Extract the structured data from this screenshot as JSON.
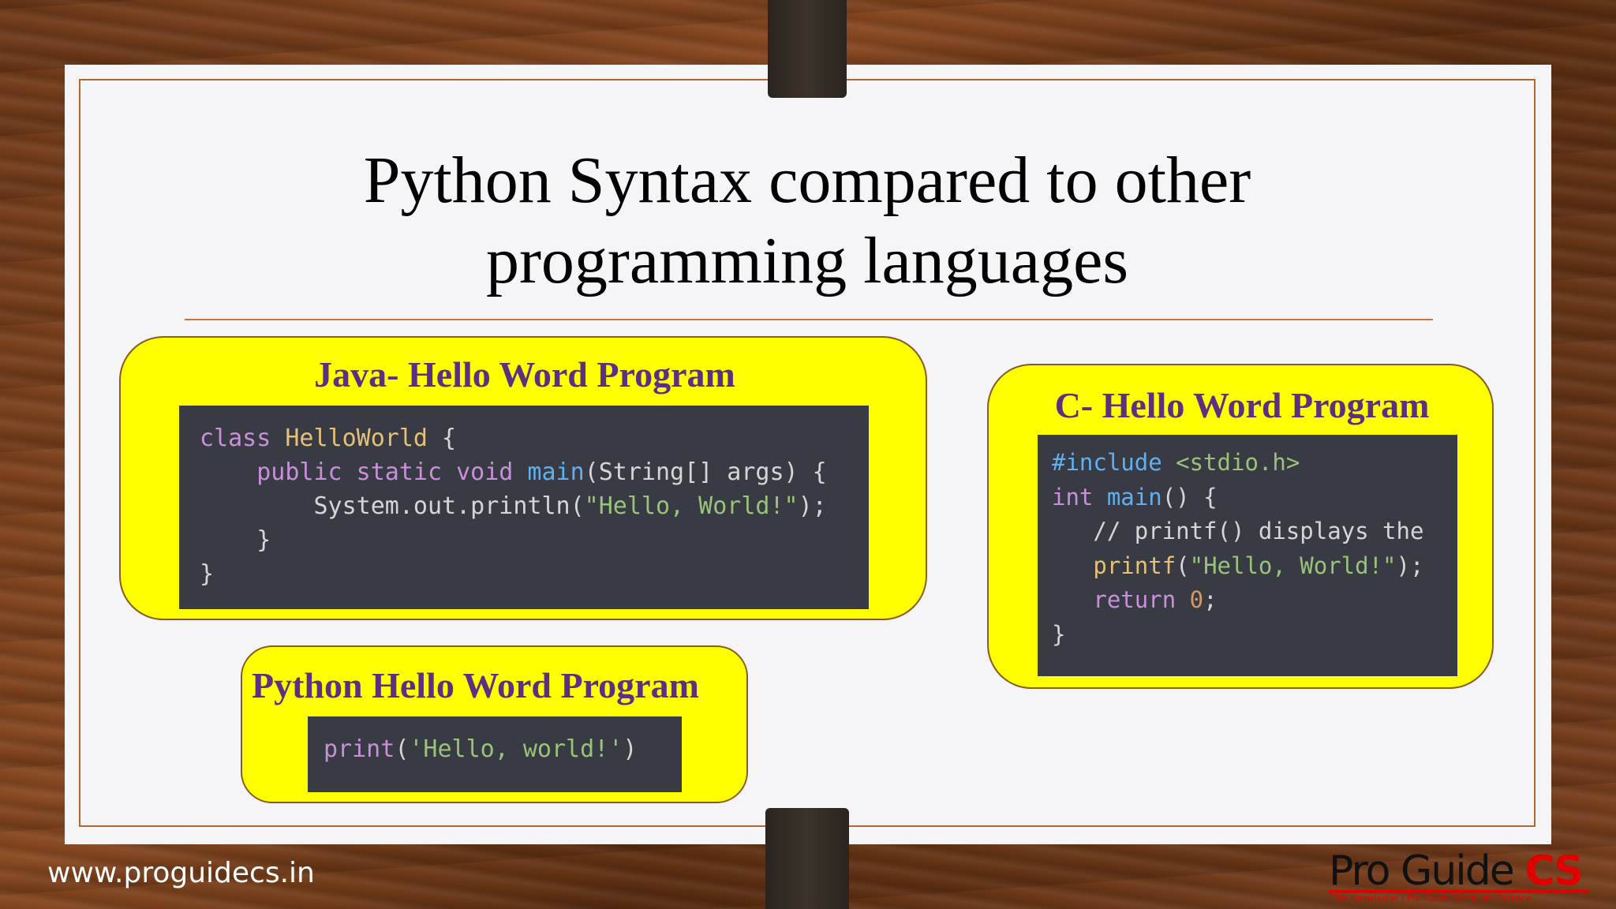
{
  "slide": {
    "title_line1": "Python Syntax compared to other",
    "title_line2": "programming languages"
  },
  "java_card": {
    "title": "Java- Hello Word Program",
    "code": [
      [
        {
          "t": "class ",
          "c": "kw"
        },
        {
          "t": "HelloWorld",
          "c": "cls"
        },
        {
          "t": " {",
          "c": ""
        }
      ],
      [
        {
          "t": "    ",
          "c": ""
        },
        {
          "t": "public static void ",
          "c": "kw"
        },
        {
          "t": "main",
          "c": "fn"
        },
        {
          "t": "(String[] args) {",
          "c": ""
        }
      ],
      [
        {
          "t": "        System.out.println(",
          "c": ""
        },
        {
          "t": "\"Hello, World!\"",
          "c": "str"
        },
        {
          "t": ");",
          "c": ""
        }
      ],
      [
        {
          "t": "    }",
          "c": ""
        }
      ],
      [
        {
          "t": "}",
          "c": ""
        }
      ]
    ]
  },
  "c_card": {
    "title": "C- Hello Word Program",
    "code": [
      [
        {
          "t": "#include ",
          "c": "fn"
        },
        {
          "t": "<stdio.h>",
          "c": "hdr"
        }
      ],
      [
        {
          "t": "int ",
          "c": "kw"
        },
        {
          "t": "main",
          "c": "fn"
        },
        {
          "t": "() {",
          "c": ""
        }
      ],
      [
        {
          "t": "   // printf() displays the",
          "c": "cm"
        }
      ],
      [
        {
          "t": "   ",
          "c": ""
        },
        {
          "t": "printf",
          "c": "cls"
        },
        {
          "t": "(",
          "c": ""
        },
        {
          "t": "\"Hello, World!\"",
          "c": "str"
        },
        {
          "t": ");",
          "c": ""
        }
      ],
      [
        {
          "t": "   ",
          "c": ""
        },
        {
          "t": "return ",
          "c": "kw"
        },
        {
          "t": "0",
          "c": "num"
        },
        {
          "t": ";",
          "c": ""
        }
      ],
      [
        {
          "t": "}",
          "c": ""
        }
      ]
    ]
  },
  "python_card": {
    "title": "Python Hello Word Program",
    "code": [
      [
        {
          "t": "print",
          "c": "kw"
        },
        {
          "t": "(",
          "c": ""
        },
        {
          "t": "'Hello, world!'",
          "c": "str"
        },
        {
          "t": ")",
          "c": ""
        }
      ]
    ]
  },
  "footer": {
    "url": "www.proguidecs.in",
    "logo_text": "Pro Guide",
    "logo_cs": "CS",
    "logo_tagline": "The Knowledge | Pro Guide Computer Science"
  },
  "colors": {
    "card_fill": "#ffff00",
    "card_title": "#5c3080",
    "code_bg": "#383b43",
    "accent_rule": "#c4773f"
  }
}
